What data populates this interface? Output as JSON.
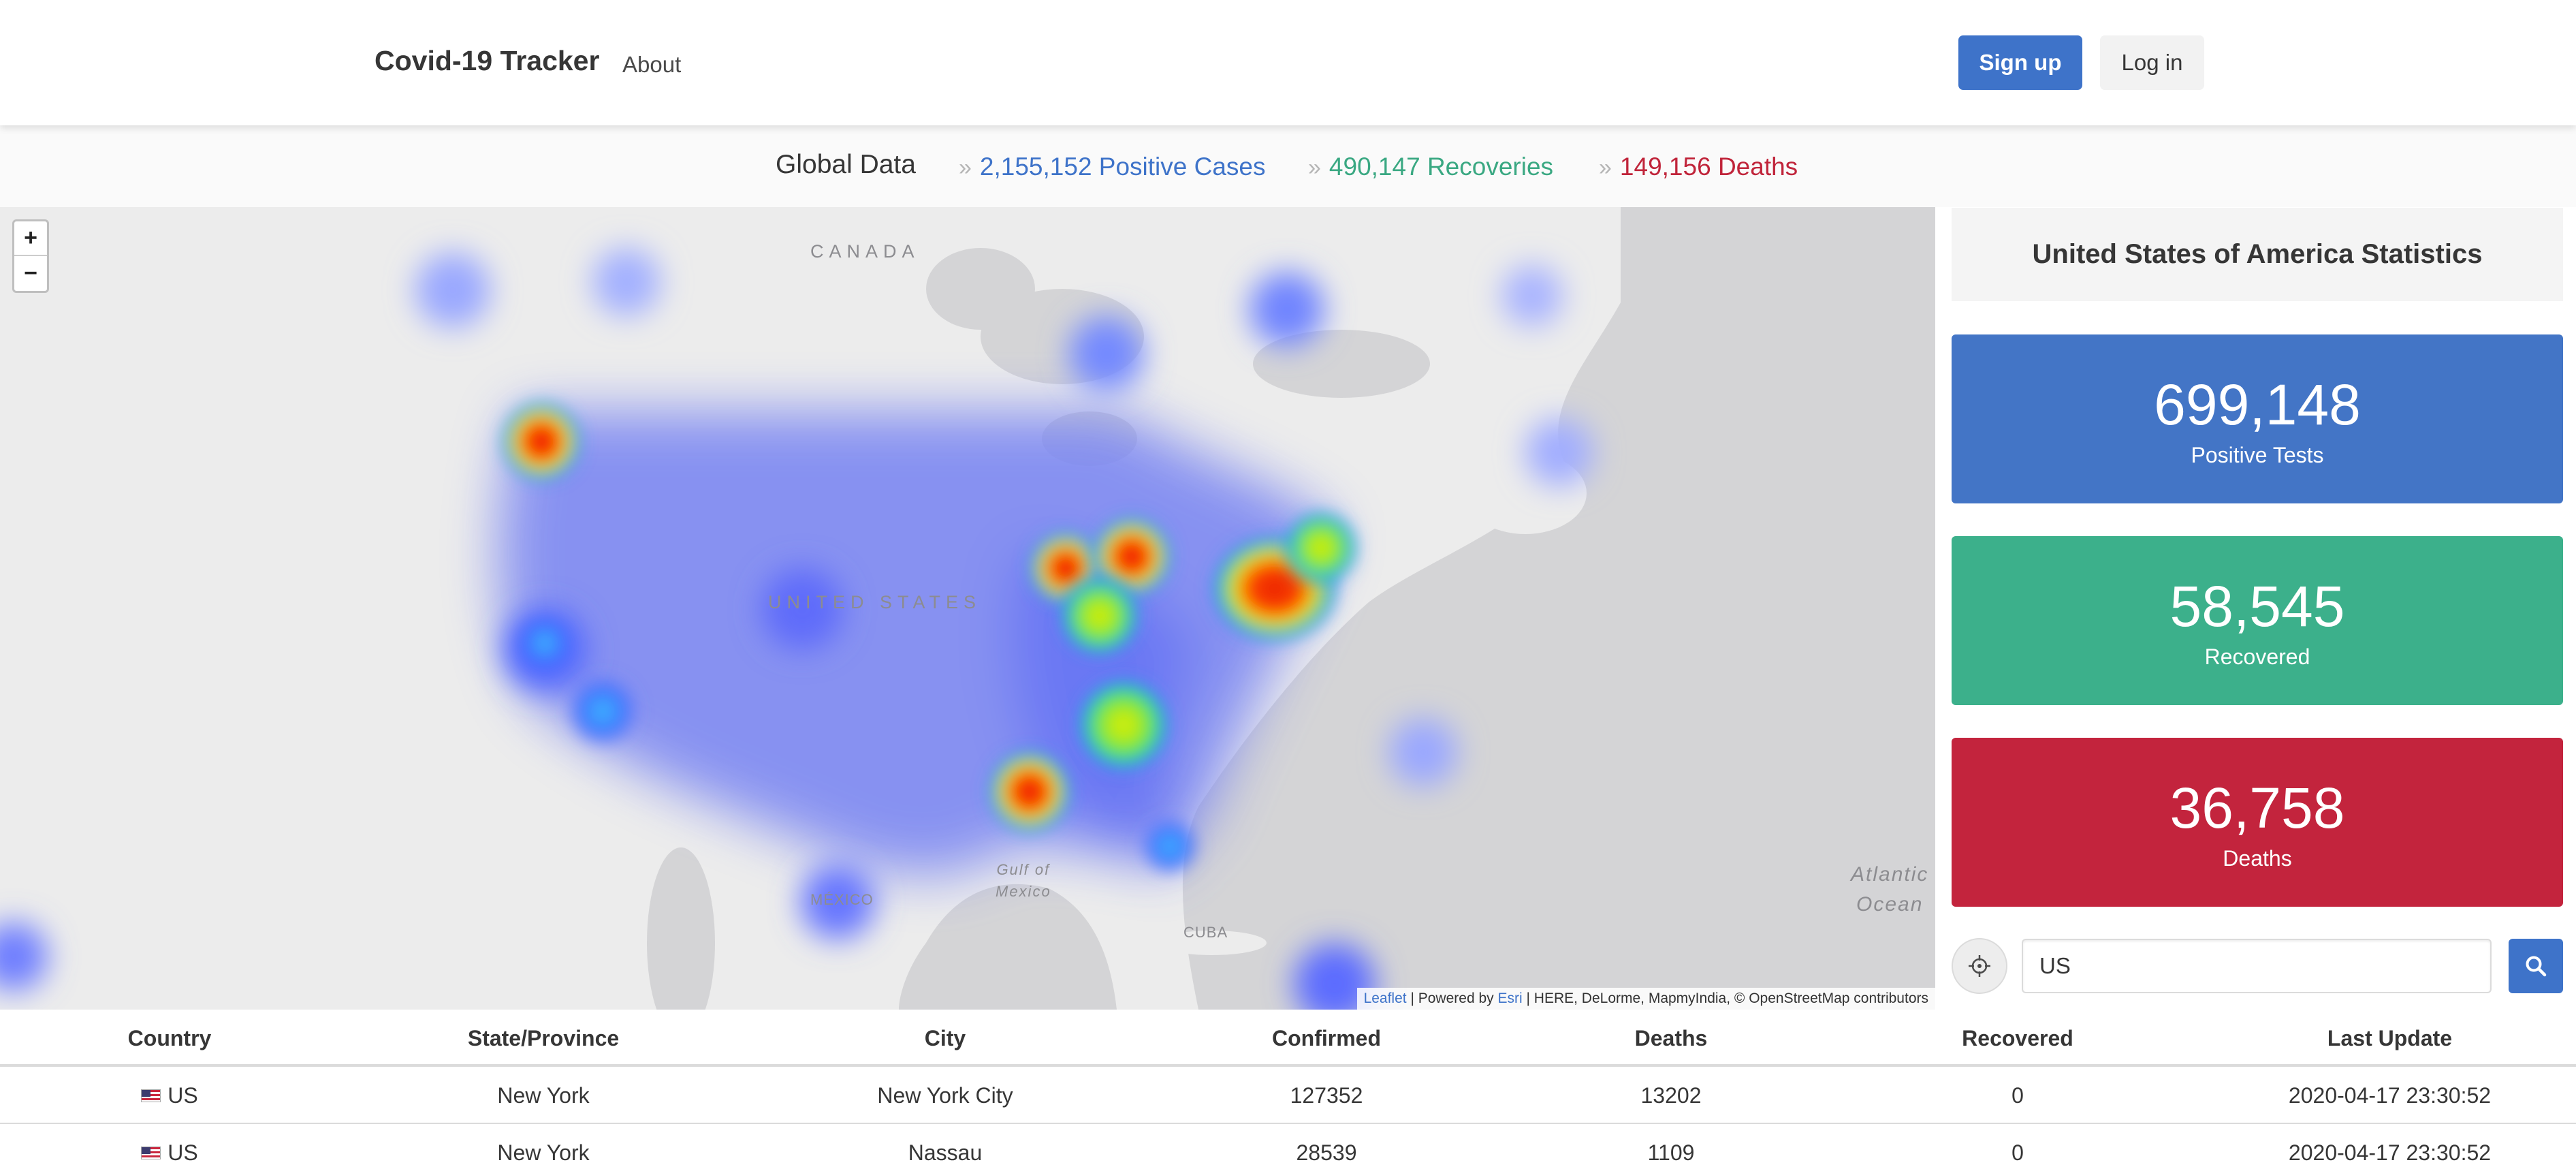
{
  "navbar": {
    "brand": "Covid-19 Tracker",
    "about_label": "About",
    "signup_label": "Sign up",
    "login_label": "Log in"
  },
  "global": {
    "title": "Global Data",
    "separator": "»",
    "positive": "2,155,152 Positive Cases",
    "recoveries": "490,147 Recoveries",
    "deaths": "149,156 Deaths"
  },
  "map": {
    "zoom_in_label": "+",
    "zoom_out_label": "−",
    "labels": {
      "canada": "CANADA",
      "united_states": "UNITED STATES",
      "mexico": "MÉXICO",
      "cuba": "CUBA",
      "gulf_line1": "Gulf of",
      "gulf_line2": "Mexico",
      "atlantic_line1": "Atlantic",
      "atlantic_line2": "Ocean"
    },
    "attribution": {
      "leaflet": "Leaflet",
      "powered_by": " | Powered by ",
      "esri": "Esri",
      "rest": " | HERE, DeLorme, MapmyIndia, © OpenStreetMap contributors"
    }
  },
  "stats": {
    "title": "United States of America Statistics",
    "positive_value": "699,148",
    "positive_label": "Positive Tests",
    "recovered_value": "58,545",
    "recovered_label": "Recovered",
    "deaths_value": "36,758",
    "deaths_label": "Deaths",
    "colors": {
      "positive": "#4375c6",
      "recovered": "#3cb08b",
      "deaths": "#c3243d"
    }
  },
  "search": {
    "value": "US",
    "locate_icon": "crosshair-icon",
    "search_icon": "search-icon"
  },
  "table": {
    "headers": [
      "Country",
      "State/Province",
      "City",
      "Confirmed",
      "Deaths",
      "Recovered",
      "Last Update"
    ],
    "rows": [
      {
        "country": "US",
        "state": "New York",
        "city": "New York City",
        "confirmed": "127352",
        "deaths": "13202",
        "recovered": "0",
        "last_update": "2020-04-17 23:30:52"
      },
      {
        "country": "US",
        "state": "New York",
        "city": "Nassau",
        "confirmed": "28539",
        "deaths": "1109",
        "recovered": "0",
        "last_update": "2020-04-17 23:30:52"
      }
    ]
  }
}
